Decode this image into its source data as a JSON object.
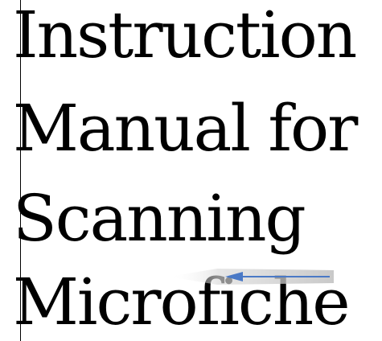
{
  "document": {
    "title_lines": [
      "Instruction",
      "Manual for",
      "Scanning",
      "Microfiche"
    ],
    "accent_color": "#4a79c6",
    "arrow_icon": "left-arrow-icon"
  }
}
